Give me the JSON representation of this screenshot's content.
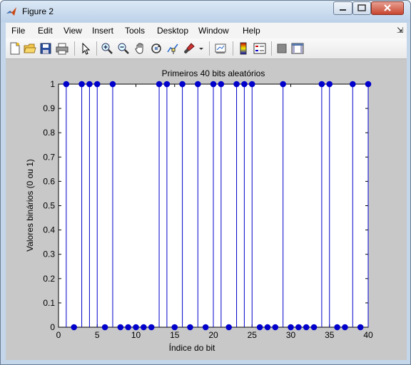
{
  "window": {
    "title": "Figure 2"
  },
  "menu": {
    "file": "File",
    "edit": "Edit",
    "view": "View",
    "insert": "Insert",
    "tools": "Tools",
    "desktop": "Desktop",
    "window": "Window",
    "help": "Help"
  },
  "toolbar_icons": [
    "new-figure-icon",
    "open-file-icon",
    "save-icon",
    "print-icon",
    "pointer-icon",
    "zoom-in-icon",
    "zoom-out-icon",
    "pan-hand-icon",
    "rotate-3d-icon",
    "data-cursor-icon",
    "brush-icon",
    "brush-dropdown-icon",
    "link-plot-icon",
    "colorbar-icon",
    "legend-icon",
    "hide-plot-tools-icon",
    "show-plot-tools-icon"
  ],
  "chart_data": {
    "type": "stem",
    "title": "Primeiros 40 bits aleatórios",
    "xlabel": "Índice do bit",
    "ylabel": "Valores binários (0 ou 1)",
    "xlim": [
      0,
      40
    ],
    "ylim": [
      0,
      1
    ],
    "xticks": [
      "0",
      "5",
      "10",
      "15",
      "20",
      "25",
      "30",
      "35",
      "40"
    ],
    "yticks": [
      "0",
      "0.1",
      "0.2",
      "0.3",
      "0.4",
      "0.5",
      "0.6",
      "0.7",
      "0.8",
      "0.9",
      "1"
    ],
    "x": [
      1,
      2,
      3,
      4,
      5,
      6,
      7,
      8,
      9,
      10,
      11,
      12,
      13,
      14,
      15,
      16,
      17,
      18,
      19,
      20,
      21,
      22,
      23,
      24,
      25,
      26,
      27,
      28,
      29,
      30,
      31,
      32,
      33,
      34,
      35,
      36,
      37,
      38,
      39,
      40
    ],
    "values": [
      1,
      0,
      1,
      1,
      1,
      0,
      1,
      0,
      0,
      0,
      0,
      0,
      1,
      1,
      0,
      1,
      0,
      1,
      0,
      1,
      1,
      0,
      1,
      1,
      1,
      0,
      0,
      0,
      1,
      0,
      0,
      0,
      0,
      1,
      1,
      0,
      0,
      1,
      0,
      1
    ],
    "series_color": "#0000cc",
    "background": "#ffffff",
    "grid": false
  }
}
